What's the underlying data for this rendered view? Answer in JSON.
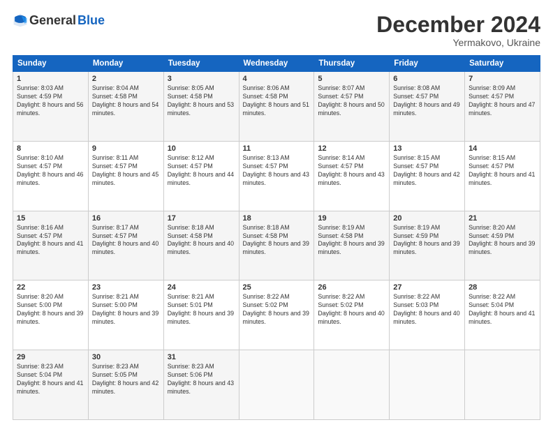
{
  "header": {
    "logo_general": "General",
    "logo_blue": "Blue",
    "month_title": "December 2024",
    "location": "Yermakovo, Ukraine"
  },
  "weekdays": [
    "Sunday",
    "Monday",
    "Tuesday",
    "Wednesday",
    "Thursday",
    "Friday",
    "Saturday"
  ],
  "weeks": [
    [
      {
        "day": "1",
        "sunrise": "8:03 AM",
        "sunset": "4:59 PM",
        "daylight": "8 hours and 56 minutes."
      },
      {
        "day": "2",
        "sunrise": "8:04 AM",
        "sunset": "4:58 PM",
        "daylight": "8 hours and 54 minutes."
      },
      {
        "day": "3",
        "sunrise": "8:05 AM",
        "sunset": "4:58 PM",
        "daylight": "8 hours and 53 minutes."
      },
      {
        "day": "4",
        "sunrise": "8:06 AM",
        "sunset": "4:58 PM",
        "daylight": "8 hours and 51 minutes."
      },
      {
        "day": "5",
        "sunrise": "8:07 AM",
        "sunset": "4:57 PM",
        "daylight": "8 hours and 50 minutes."
      },
      {
        "day": "6",
        "sunrise": "8:08 AM",
        "sunset": "4:57 PM",
        "daylight": "8 hours and 49 minutes."
      },
      {
        "day": "7",
        "sunrise": "8:09 AM",
        "sunset": "4:57 PM",
        "daylight": "8 hours and 47 minutes."
      }
    ],
    [
      {
        "day": "8",
        "sunrise": "8:10 AM",
        "sunset": "4:57 PM",
        "daylight": "8 hours and 46 minutes."
      },
      {
        "day": "9",
        "sunrise": "8:11 AM",
        "sunset": "4:57 PM",
        "daylight": "8 hours and 45 minutes."
      },
      {
        "day": "10",
        "sunrise": "8:12 AM",
        "sunset": "4:57 PM",
        "daylight": "8 hours and 44 minutes."
      },
      {
        "day": "11",
        "sunrise": "8:13 AM",
        "sunset": "4:57 PM",
        "daylight": "8 hours and 43 minutes."
      },
      {
        "day": "12",
        "sunrise": "8:14 AM",
        "sunset": "4:57 PM",
        "daylight": "8 hours and 43 minutes."
      },
      {
        "day": "13",
        "sunrise": "8:15 AM",
        "sunset": "4:57 PM",
        "daylight": "8 hours and 42 minutes."
      },
      {
        "day": "14",
        "sunrise": "8:15 AM",
        "sunset": "4:57 PM",
        "daylight": "8 hours and 41 minutes."
      }
    ],
    [
      {
        "day": "15",
        "sunrise": "8:16 AM",
        "sunset": "4:57 PM",
        "daylight": "8 hours and 41 minutes."
      },
      {
        "day": "16",
        "sunrise": "8:17 AM",
        "sunset": "4:57 PM",
        "daylight": "8 hours and 40 minutes."
      },
      {
        "day": "17",
        "sunrise": "8:18 AM",
        "sunset": "4:58 PM",
        "daylight": "8 hours and 40 minutes."
      },
      {
        "day": "18",
        "sunrise": "8:18 AM",
        "sunset": "4:58 PM",
        "daylight": "8 hours and 39 minutes."
      },
      {
        "day": "19",
        "sunrise": "8:19 AM",
        "sunset": "4:58 PM",
        "daylight": "8 hours and 39 minutes."
      },
      {
        "day": "20",
        "sunrise": "8:19 AM",
        "sunset": "4:59 PM",
        "daylight": "8 hours and 39 minutes."
      },
      {
        "day": "21",
        "sunrise": "8:20 AM",
        "sunset": "4:59 PM",
        "daylight": "8 hours and 39 minutes."
      }
    ],
    [
      {
        "day": "22",
        "sunrise": "8:20 AM",
        "sunset": "5:00 PM",
        "daylight": "8 hours and 39 minutes."
      },
      {
        "day": "23",
        "sunrise": "8:21 AM",
        "sunset": "5:00 PM",
        "daylight": "8 hours and 39 minutes."
      },
      {
        "day": "24",
        "sunrise": "8:21 AM",
        "sunset": "5:01 PM",
        "daylight": "8 hours and 39 minutes."
      },
      {
        "day": "25",
        "sunrise": "8:22 AM",
        "sunset": "5:02 PM",
        "daylight": "8 hours and 39 minutes."
      },
      {
        "day": "26",
        "sunrise": "8:22 AM",
        "sunset": "5:02 PM",
        "daylight": "8 hours and 40 minutes."
      },
      {
        "day": "27",
        "sunrise": "8:22 AM",
        "sunset": "5:03 PM",
        "daylight": "8 hours and 40 minutes."
      },
      {
        "day": "28",
        "sunrise": "8:22 AM",
        "sunset": "5:04 PM",
        "daylight": "8 hours and 41 minutes."
      }
    ],
    [
      {
        "day": "29",
        "sunrise": "8:23 AM",
        "sunset": "5:04 PM",
        "daylight": "8 hours and 41 minutes."
      },
      {
        "day": "30",
        "sunrise": "8:23 AM",
        "sunset": "5:05 PM",
        "daylight": "8 hours and 42 minutes."
      },
      {
        "day": "31",
        "sunrise": "8:23 AM",
        "sunset": "5:06 PM",
        "daylight": "8 hours and 43 minutes."
      },
      null,
      null,
      null,
      null
    ]
  ],
  "labels": {
    "sunrise": "Sunrise:",
    "sunset": "Sunset:",
    "daylight": "Daylight:"
  }
}
